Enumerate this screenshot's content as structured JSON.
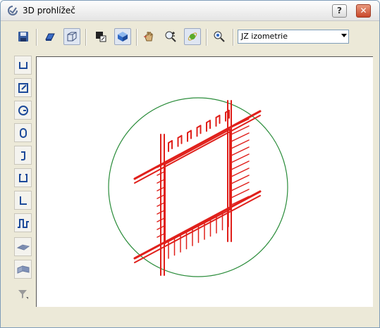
{
  "window": {
    "title": "3D prohlížeč",
    "help_label": "?",
    "close_label": "✕"
  },
  "toolbar": {
    "icons": [
      "save-icon",
      "rotate-view-icon",
      "wireframe-box-icon",
      "hidden-lines-icon",
      "shaded-solid-icon",
      "hand-pan-icon",
      "zoom-plus-minus-icon",
      "orbit-icon",
      "zoom-window-icon"
    ],
    "view_select": {
      "value": "JZ izometrie"
    }
  },
  "left_toolbar": {
    "icons": [
      "shape-u-icon",
      "shape-rect-hook-icon",
      "shape-circle-icon",
      "shape-stadium-icon",
      "shape-j-icon",
      "shape-open-rect-icon",
      "shape-l-icon",
      "shape-zigzag-icon",
      "mesh-flat-icon",
      "mesh-bent-icon",
      "filter-icon"
    ]
  },
  "colors": {
    "rebar": "#e0201b",
    "circle": "#2a8c3a"
  }
}
